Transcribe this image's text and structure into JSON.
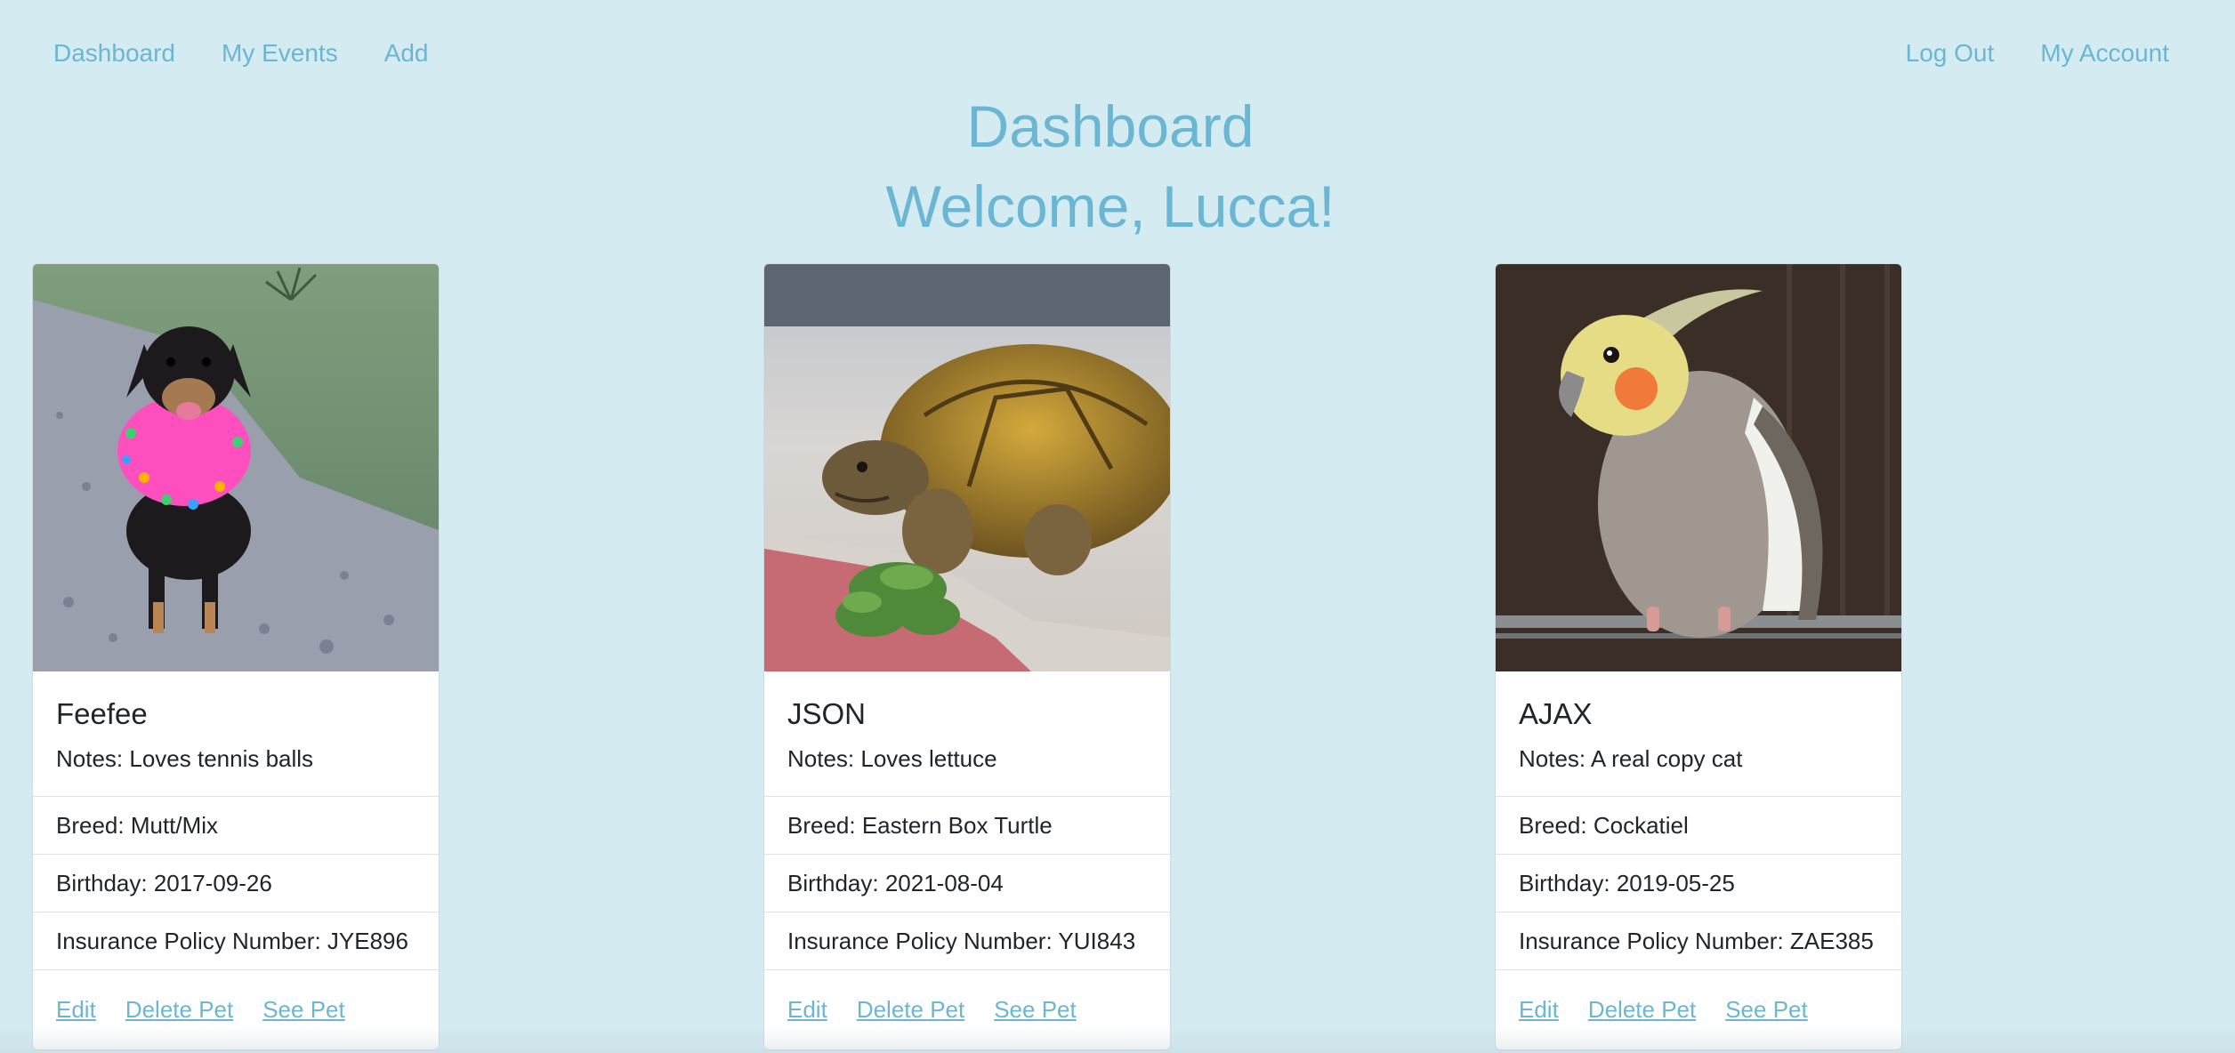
{
  "nav": {
    "left": [
      "Dashboard",
      "My Events",
      "Add"
    ],
    "right": [
      "Log Out",
      "My Account"
    ]
  },
  "header": {
    "title": "Dashboard",
    "welcome": "Welcome, Lucca!"
  },
  "pets": [
    {
      "name": "Feefee",
      "notes": "Notes: Loves tennis balls",
      "breed": "Breed: Mutt/Mix",
      "birthday": "Birthday: 2017-09-26",
      "policy": "Insurance Policy Number: JYE896",
      "photo": "dog-photo"
    },
    {
      "name": "JSON",
      "notes": "Notes: Loves lettuce",
      "breed": "Breed: Eastern Box Turtle",
      "birthday": "Birthday: 2021-08-04",
      "policy": "Insurance Policy Number: YUI843",
      "photo": "tortoise-photo"
    },
    {
      "name": "AJAX",
      "notes": "Notes: A real copy cat",
      "breed": "Breed: Cockatiel",
      "birthday": "Birthday: 2019-05-25",
      "policy": "Insurance Policy Number: ZAE385",
      "photo": "cockatiel-photo"
    }
  ],
  "actions": {
    "edit": "Edit",
    "delete": "Delete Pet",
    "see": "See Pet"
  },
  "colors": {
    "background": "#d4ebf2",
    "accent": "#6bb6d3"
  }
}
